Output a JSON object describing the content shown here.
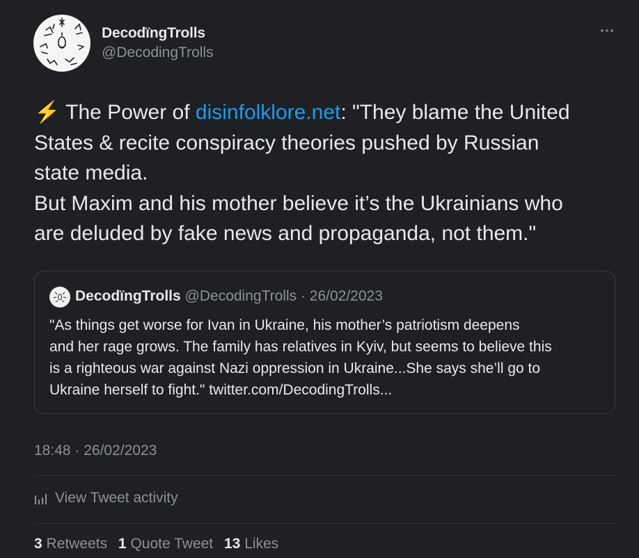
{
  "author": {
    "name": "DecodïngTrolls",
    "handle": "@DecodingTrolls"
  },
  "tweet": {
    "lines": [
      {
        "prefix": " The Power of ",
        "link": "disinfolklore.net",
        "suffix": ": \"They blame the United"
      },
      "States & recite conspiracy theories pushed by Russian",
      "state media.",
      "But Maxim and his mother believe it’s the Ukrainians who",
      "are deluded by fake news and propaganda, not them.\""
    ],
    "emoji": "⚡"
  },
  "quote": {
    "name": "DecodïngTrolls",
    "meta": "@DecodingTrolls · 26/02/2023",
    "lines": [
      "\"As things get worse for Ivan in Ukraine, his mother’s patriotism deepens",
      "and her rage grows. The family has relatives in Kyiv, but seems to believe this",
      "is a righteous war against Nazi oppression in Ukraine...She says she’ll go to",
      "Ukraine herself to fight.\" twitter.com/DecodingTrolls..."
    ]
  },
  "timestamp": "18:48 · 26/02/2023",
  "activity_label": "View Tweet activity",
  "stats": {
    "retweets": {
      "count": "3",
      "label": "Retweets"
    },
    "quotes": {
      "count": "1",
      "label": "Quote Tweet"
    },
    "likes": {
      "count": "13",
      "label": "Likes"
    }
  },
  "colors": {
    "background": "#1f2023",
    "link": "#1d9bf0",
    "muted": "#8b9196",
    "text": "#e7e9ea"
  }
}
